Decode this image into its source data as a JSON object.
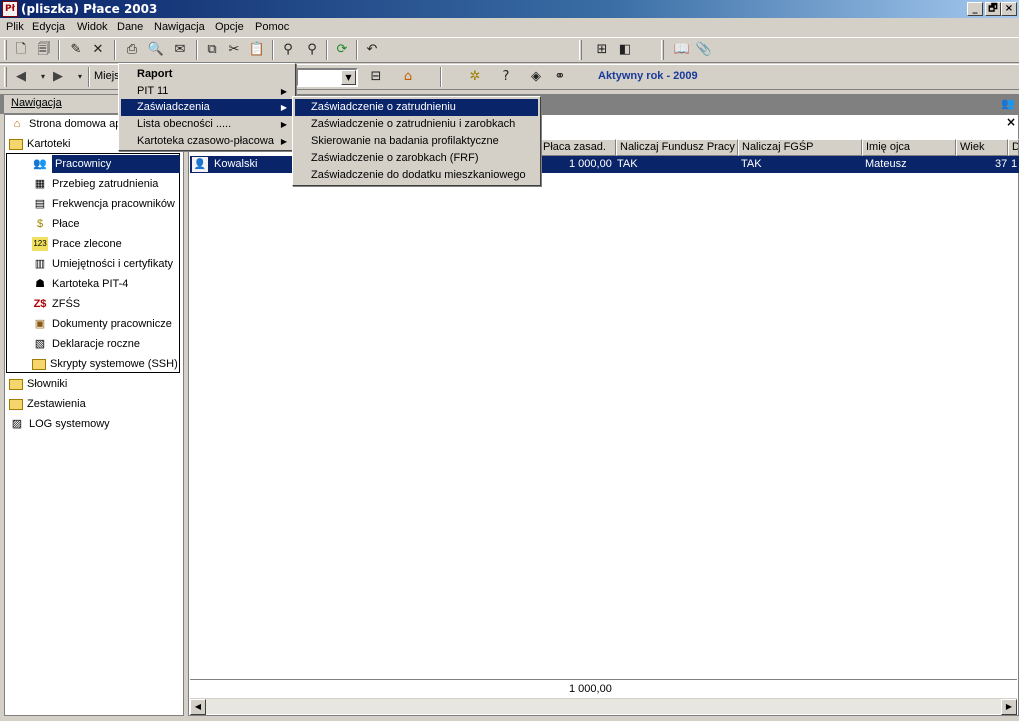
{
  "window": {
    "title": "(pliszka)  Płace 2003",
    "controls": [
      "_",
      "🗗",
      "×"
    ]
  },
  "menubar": [
    "Plik",
    "Edycja",
    "Widok",
    "Dane",
    "Nawigacja",
    "Opcje",
    "Pomoc"
  ],
  "toolbar2": {
    "address_label": "Miejs",
    "active_year": "Aktywny rok - 2009"
  },
  "navigation": {
    "header": "Nawigacja",
    "tree": {
      "home": "Strona domowa ap",
      "kartoteki": "Kartoteki",
      "kartoteki_items": [
        "Pracownicy",
        "Przebieg zatrudnienia",
        "Frekwencja pracowników",
        "Płace",
        "Prace zlecone",
        "Umiejętności i certyfikaty",
        "Kartoteka PIT-4",
        "ZFŚS",
        "Dokumenty pracownicze",
        "Deklaracje roczne",
        "Skrypty systemowe (SSH)"
      ],
      "slowniki": "Słowniki",
      "zestawienia": "Zestawienia",
      "log": "LOG systemowy"
    }
  },
  "grid": {
    "columns": [
      "Płaca zasad.",
      "Naliczaj Fundusz Pracy",
      "Naliczaj FGŚP",
      "Imię ojca",
      "Wiek",
      "D"
    ],
    "row": {
      "name": "Kowalski",
      "placa": "1 000,00",
      "fundusz": "TAK",
      "fgsp": "TAK",
      "imie_ojca": "Mateusz",
      "wiek": "37",
      "extra": "1"
    },
    "sum": "1 000,00",
    "close": "×"
  },
  "menu_main": {
    "items": [
      "Raport",
      "PIT 11",
      "Zaświadczenia",
      "Lista obecności .....",
      "Kartoteka czasowo-płacowa"
    ]
  },
  "menu_sub": {
    "items": [
      "Zaświadczenie o zatrudnieniu",
      "Zaświadczenie o zatrudnieniu i zarobkach",
      "Skierowanie na badania profilaktyczne",
      "Zaświadczenie o zarobkach (FRF)",
      "Zaświadczenie do dodatku mieszkaniowego"
    ]
  },
  "colors": {
    "selection": "#0a246a",
    "face": "#d4d0c8",
    "active_year": "#1a3a9a"
  }
}
